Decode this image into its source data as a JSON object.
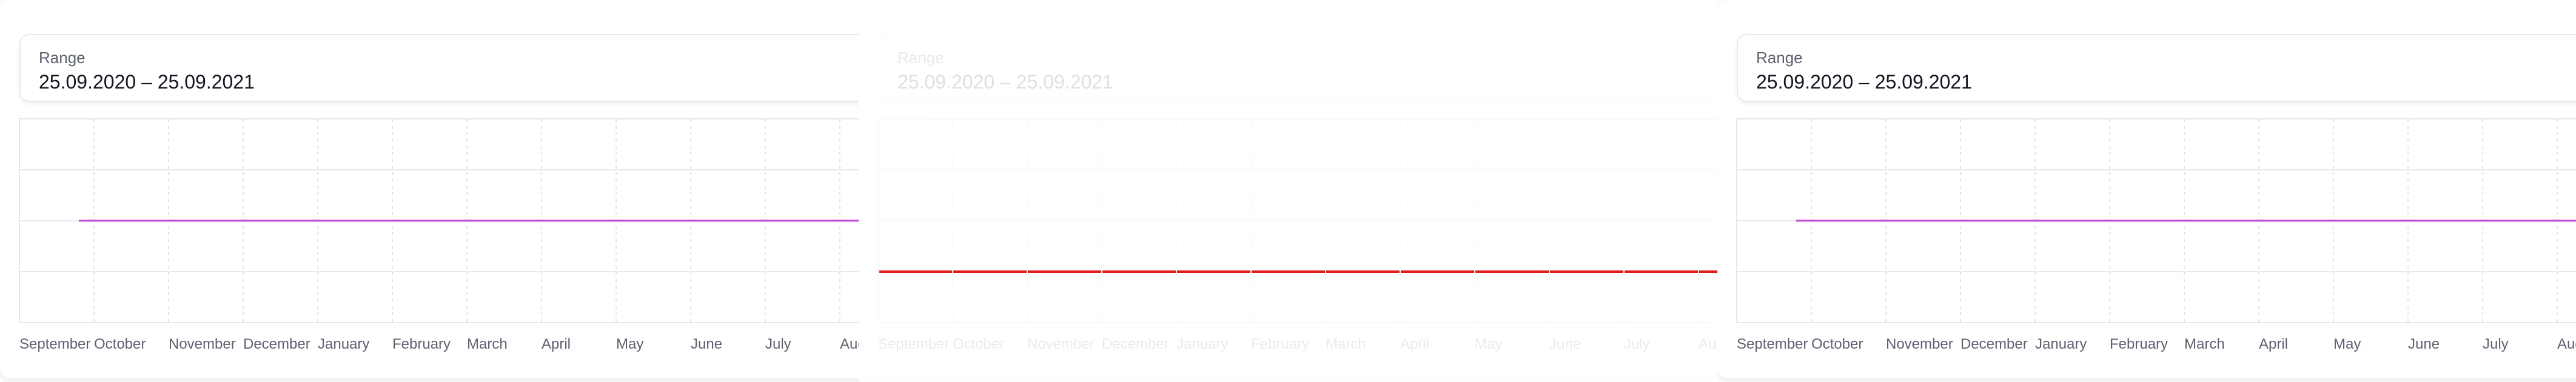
{
  "panels": [
    {
      "range": {
        "label": "Range",
        "value": "25.09.2020 – 25.09.2021"
      },
      "chart_data": {
        "type": "line",
        "x_tick_labels": [
          "September",
          "October",
          "November",
          "December",
          "January",
          "February",
          "March",
          "April",
          "May",
          "June",
          "July",
          "August"
        ],
        "xlim": [
          "2020-09-25",
          "2021-09-25"
        ],
        "grid": true,
        "series": [
          {
            "color": "#c04ad8",
            "x": [
              "2020-09-25",
              "2021-09-25"
            ],
            "y": [
              2,
              2
            ]
          }
        ],
        "ylim": [
          0,
          4
        ]
      }
    },
    {
      "range": {
        "label": "Range",
        "value": "25.09.2020 – 25.09.2021"
      },
      "faded": true,
      "chart_data": {
        "type": "line",
        "x_tick_labels": [
          "September",
          "October",
          "November",
          "December",
          "January",
          "February",
          "March",
          "April",
          "May",
          "June",
          "July",
          "August"
        ],
        "xlim": [
          "2020-09-25",
          "2021-09-25"
        ],
        "grid": true,
        "series": [
          {
            "color": "#e41b1b",
            "x": [
              "2020-09-25",
              "2021-09-25"
            ],
            "y": [
              1,
              1
            ]
          }
        ],
        "ylim": [
          0,
          4
        ]
      }
    },
    {
      "range": {
        "label": "Range",
        "value": "25.09.2020 – 25.09.2021"
      },
      "chart_data": {
        "type": "line",
        "x_tick_labels": [
          "September",
          "October",
          "November",
          "December",
          "January",
          "February",
          "March",
          "April",
          "May",
          "June",
          "July",
          "August"
        ],
        "xlim": [
          "2020-09-25",
          "2021-09-25"
        ],
        "grid": true,
        "series": [
          {
            "color": "#c04ad8",
            "x": [
              "2020-09-25",
              "2021-09-25"
            ],
            "y": [
              2,
              2
            ]
          }
        ],
        "ylim": [
          0,
          4
        ]
      }
    }
  ]
}
